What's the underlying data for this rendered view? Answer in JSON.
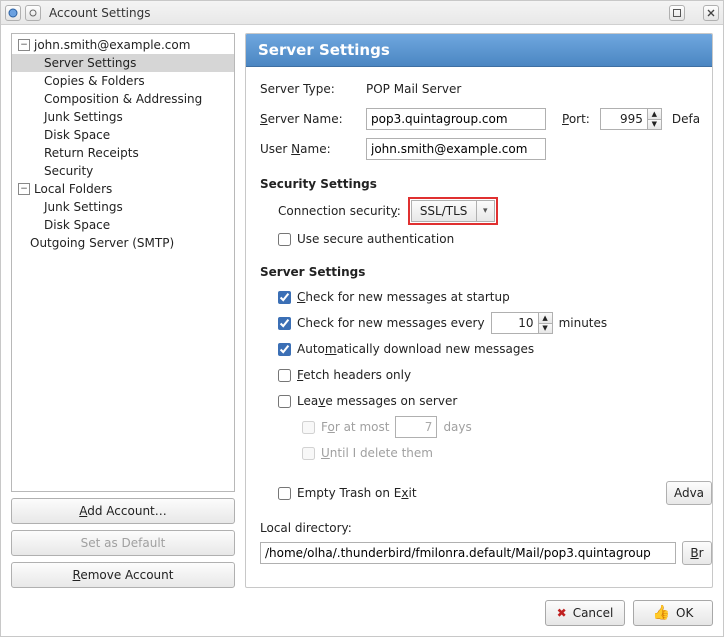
{
  "window": {
    "title": "Account Settings"
  },
  "tree": {
    "account_email": "john.smith@example.com",
    "items_email": [
      "Server Settings",
      "Copies & Folders",
      "Composition & Addressing",
      "Junk Settings",
      "Disk Space",
      "Return Receipts",
      "Security"
    ],
    "local_label": "Local Folders",
    "items_local": [
      "Junk Settings",
      "Disk Space"
    ],
    "smtp_label": "Outgoing Server (SMTP)"
  },
  "left_buttons": {
    "add": "Add Account…",
    "set_default": "Set as Default",
    "remove": "Remove Account"
  },
  "pane": {
    "heading": "Server Settings",
    "server_type_label": "Server Type:",
    "server_type_value": "POP Mail Server",
    "server_name_label": "Server Name:",
    "server_name_value": "pop3.quintagroup.com",
    "port_label": "Port:",
    "port_value": "995",
    "default_port_label": "Defa",
    "user_name_label": "User Name:",
    "user_name_value": "john.smith@example.com",
    "security_heading": "Security Settings",
    "conn_sec_label": "Connection security:",
    "conn_sec_value": "SSL/TLS",
    "secure_auth_label": "Use secure authentication",
    "server_settings_heading": "Server Settings",
    "check_startup_label": "Check for new messages at startup",
    "check_every_prefix": "Check for new messages every",
    "check_every_value": "10",
    "check_every_suffix": "minutes",
    "auto_dl_label": "Automatically download new messages",
    "fetch_headers_label": "Fetch headers only",
    "leave_server_label": "Leave messages on server",
    "for_at_most_label": "For at most",
    "for_at_most_value": "7",
    "for_at_most_suffix": "days",
    "until_delete_label": "Until I delete them",
    "empty_trash_label": "Empty Trash on Exit",
    "advanced_btn": "Adva",
    "local_dir_label": "Local directory:",
    "local_dir_value": "/home/olha/.thunderbird/fmilonra.default/Mail/pop3.quintagroup",
    "browse_btn": "Br"
  },
  "footer": {
    "cancel": "Cancel",
    "ok": "OK"
  }
}
